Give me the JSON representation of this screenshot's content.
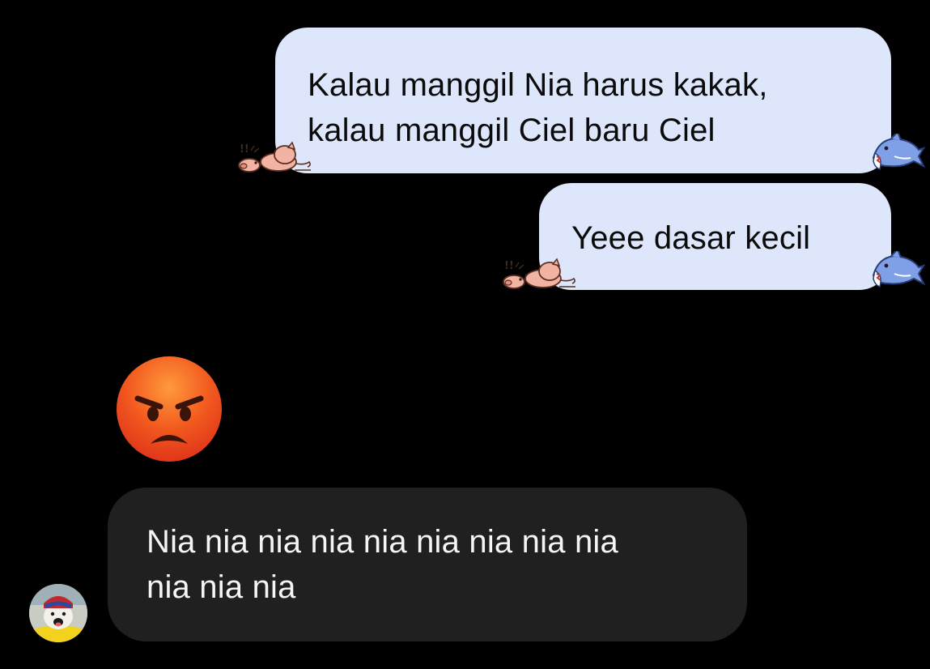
{
  "conversation": {
    "messages": [
      {
        "direction": "outgoing",
        "lines": [
          "Kalau manggil Nia harus kakak,",
          "kalau manggil Ciel baru Ciel"
        ],
        "bubble_color": "#dde6fb",
        "reactions": [
          "pig-sticker",
          "shark-sticker"
        ]
      },
      {
        "direction": "outgoing",
        "lines": [
          "Yeee dasar kecil"
        ],
        "bubble_color": "#dde6fb",
        "reactions": [
          "pig-sticker",
          "shark-sticker"
        ]
      },
      {
        "direction": "incoming",
        "emoji_icon": "angry-face-emoji"
      },
      {
        "direction": "incoming",
        "lines": [
          "Nia nia nia nia nia nia nia nia nia",
          "nia nia nia"
        ],
        "bubble_color": "#202020",
        "sender_avatar_icon": "dog-avatar"
      }
    ]
  },
  "colors": {
    "background": "#000000",
    "outgoing_text": "#0b0b0b",
    "incoming_text": "#f5f5f5"
  }
}
